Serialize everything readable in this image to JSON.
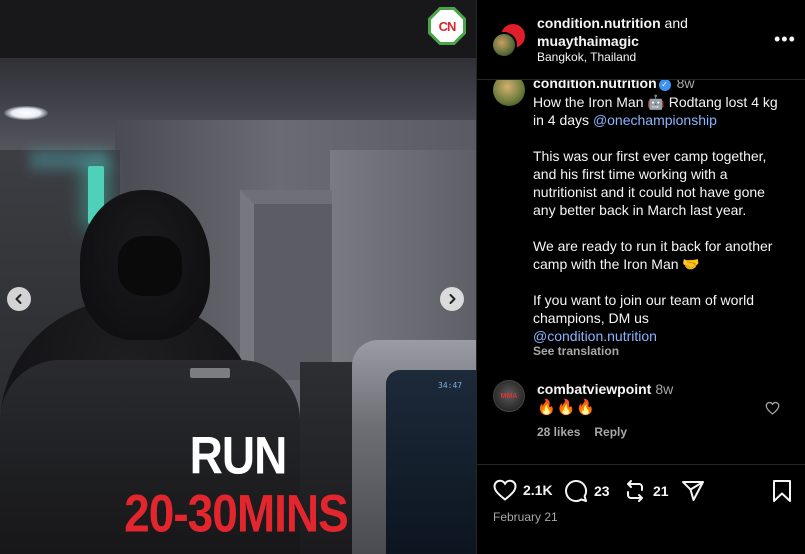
{
  "media": {
    "caption_line1": "RUN",
    "caption_line2": "20-30MINS",
    "logo_text": "CN",
    "screen_readout": "34:47",
    "colors": {
      "caption_primary": "#ffffff",
      "caption_accent": "#e3262d",
      "logo_ring": "#4aa548"
    },
    "icons": {
      "prev": "chevron-left-icon",
      "next": "chevron-right-icon"
    }
  },
  "header": {
    "user1": "condition.nutrition",
    "and": "and",
    "user2": "muaythaimagic",
    "location": "Bangkok, Thailand",
    "more_glyph": "•••"
  },
  "post": {
    "author": "condition.nutrition",
    "verified_glyph": "✓",
    "age": "8w",
    "line1_before": "How the Iron Man 🤖 Rodtang lost 4 kg in 4 days ",
    "line1_link": "@onechampionship",
    "para2": "This was our first ever camp together, and his first time working with a nutritionist and it could not have gone any better back in March last year.",
    "para3": "We are ready to run it back for another camp with the Iron Man 🤝",
    "para4_text": "If you want to join our team of world champions, DM us",
    "para4_link": "@condition.nutrition",
    "see_translation": "See translation"
  },
  "comment": {
    "user": "combatviewpoint",
    "age": "8w",
    "text": "🔥🔥🔥",
    "avatar_text": "MMA",
    "likes": "28 likes",
    "reply": "Reply"
  },
  "actions": {
    "likes": "2.1K",
    "comments": "23",
    "reposts": "21",
    "date": "February 21",
    "icons": [
      "heart-icon",
      "comment-icon",
      "repost-icon",
      "share-icon",
      "bookmark-icon"
    ]
  }
}
